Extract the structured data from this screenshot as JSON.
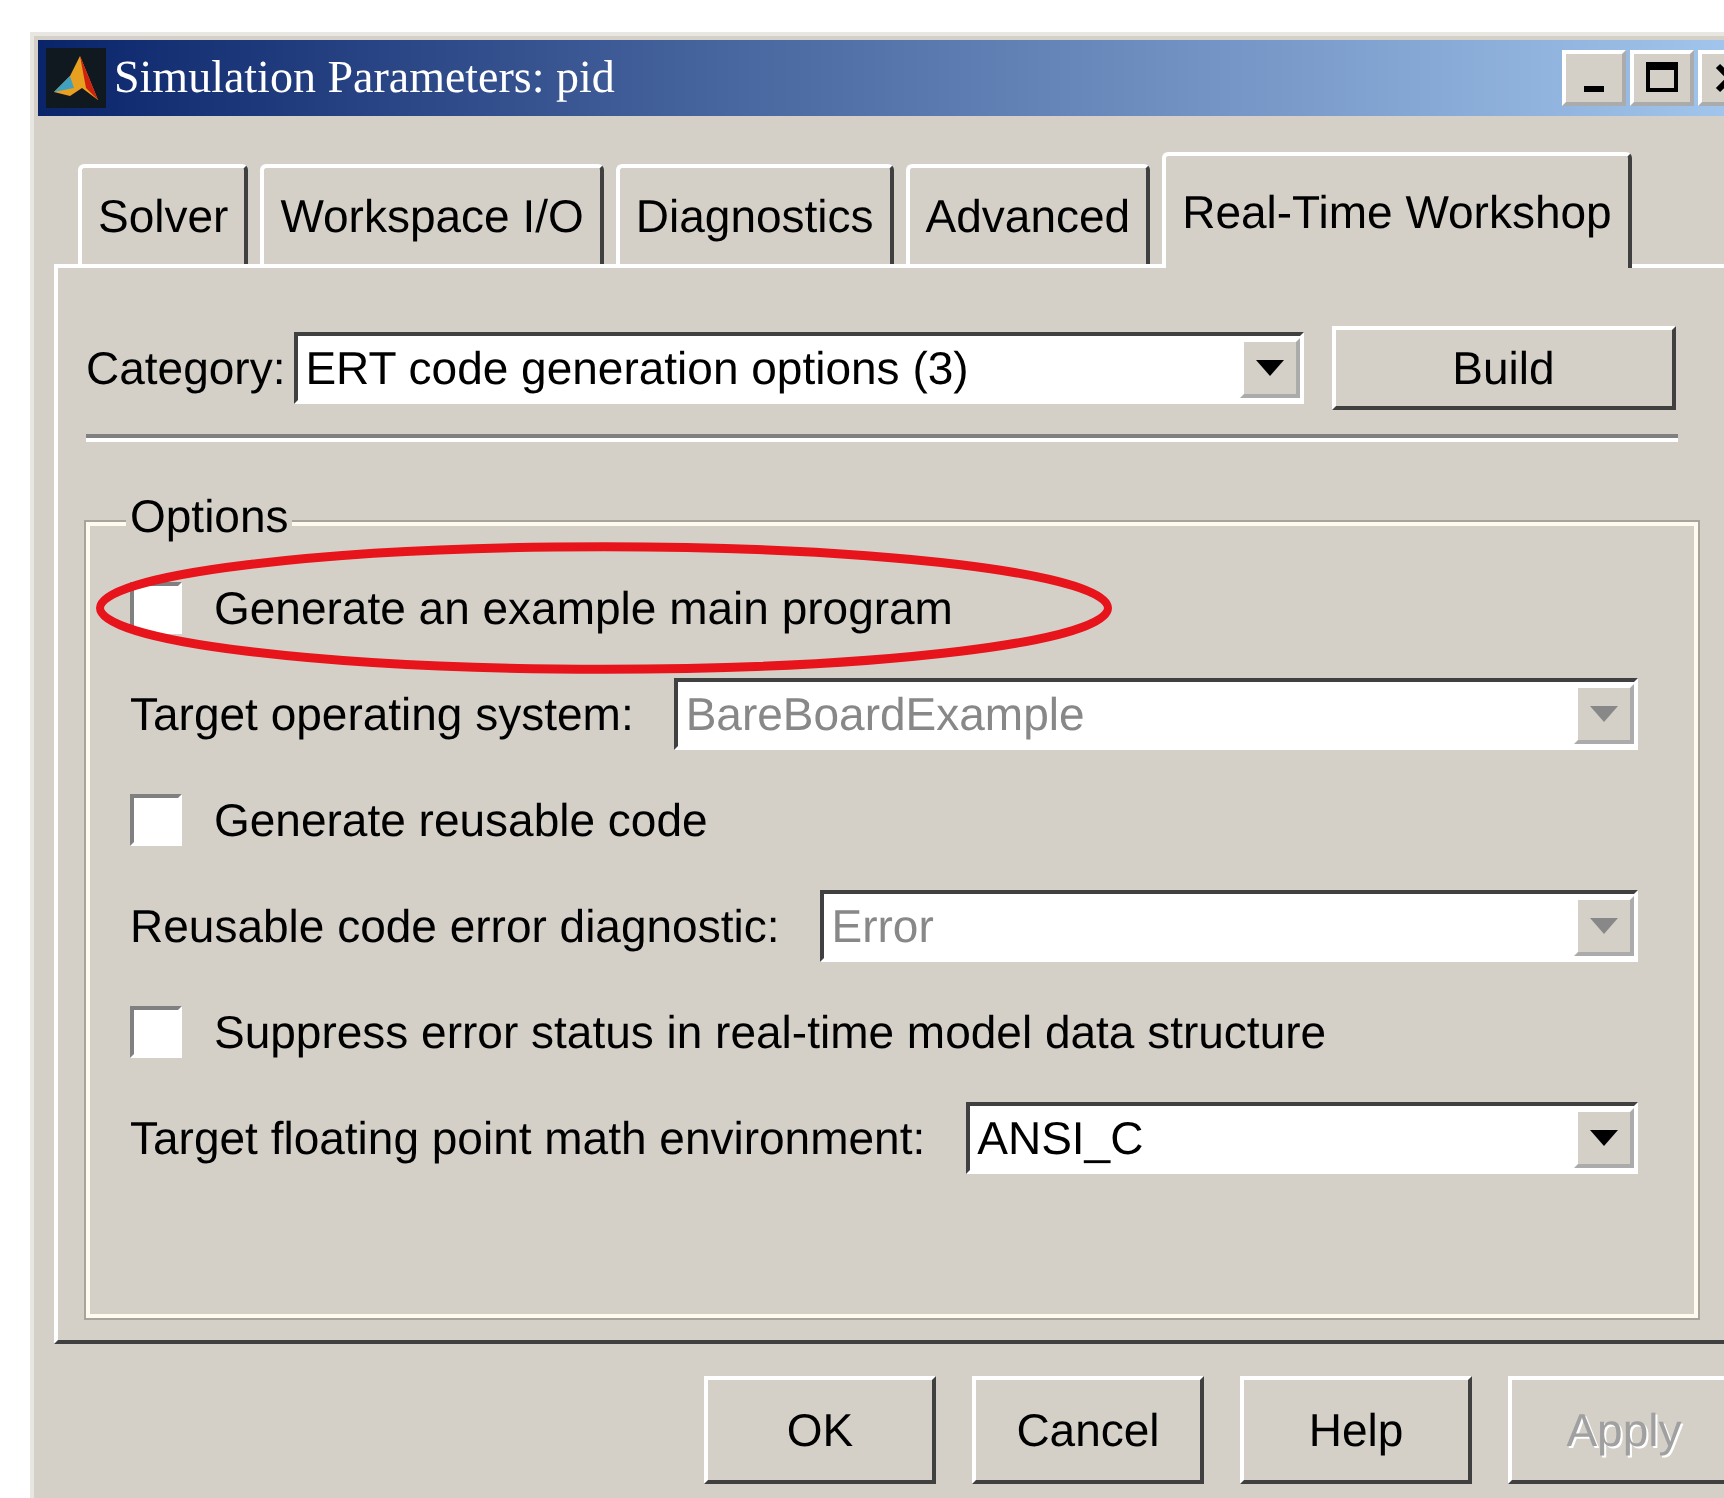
{
  "window": {
    "title": "Simulation Parameters: pid"
  },
  "tabs": [
    {
      "label": "Solver",
      "selected": false
    },
    {
      "label": "Workspace I/O",
      "selected": false
    },
    {
      "label": "Diagnostics",
      "selected": false
    },
    {
      "label": "Advanced",
      "selected": false
    },
    {
      "label": "Real-Time Workshop",
      "selected": true
    }
  ],
  "category": {
    "label": "Category:",
    "value": "ERT code generation options (3)"
  },
  "build_button": "Build",
  "options": {
    "title": "Options",
    "items": [
      {
        "kind": "checkbox",
        "label": "Generate an example main program",
        "checked": false,
        "circled": true
      },
      {
        "kind": "select",
        "label": "Target operating system:",
        "value": "BareBoardExample",
        "disabled": true
      },
      {
        "kind": "checkbox",
        "label": "Generate reusable code",
        "checked": false,
        "circled": false
      },
      {
        "kind": "select",
        "label": "Reusable code error diagnostic:",
        "value": "Error",
        "disabled": true
      },
      {
        "kind": "checkbox",
        "label": "Suppress error status in real-time model data structure",
        "checked": false,
        "circled": false
      },
      {
        "kind": "select",
        "label": "Target floating point math environment:",
        "value": "ANSI_C",
        "disabled": false
      }
    ]
  },
  "buttons": [
    {
      "label": "OK",
      "disabled": false
    },
    {
      "label": "Cancel",
      "disabled": false
    },
    {
      "label": "Help",
      "disabled": false
    },
    {
      "label": "Apply",
      "disabled": true
    }
  ]
}
